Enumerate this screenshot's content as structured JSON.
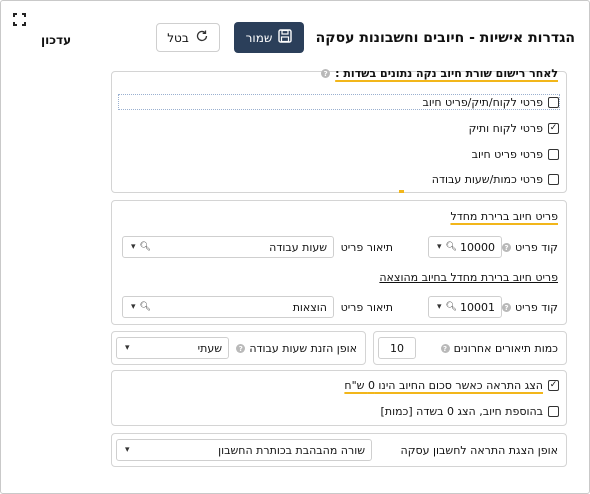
{
  "header": {
    "title": "הגדרות אישיות - חיובים וחשבונות עסקה",
    "update_label": "עדכון",
    "save_label": "שמור",
    "cancel_label": "בטל"
  },
  "section_after_line": {
    "heading": "לאחר רישום שורת חיוב נקה נתונים בשדות :",
    "options": [
      {
        "label": "פרטי לקוח/תיק/פריט חיוב",
        "checked": false
      },
      {
        "label": "פרטי לקוח ותיק",
        "checked": true
      },
      {
        "label": "פרטי פריט חיוב",
        "checked": false
      },
      {
        "label": "פרטי כמות/שעות עבודה",
        "checked": false
      }
    ]
  },
  "section_default_item": {
    "heading": "פריט חיוב ברירת מחדל",
    "code_label": "קוד פריט",
    "code_value": "10000",
    "desc_label": "תיאור פריט",
    "desc_value": "שעות עבודה",
    "heading_expense": "פריט חיוב ברירת מחדל בחיוב מהוצאה",
    "expense_code_label": "קוד פריט",
    "expense_code_value": "10001",
    "expense_desc_label": "תיאור פריט",
    "expense_desc_value": "הוצאות"
  },
  "section_quantity": {
    "recent_label": "כמות תיאורים אחרונים",
    "recent_value": "10",
    "hours_mode_label": "אופן הזנת שעות עבודה",
    "hours_mode_value": "שעתי"
  },
  "section_warning": {
    "warn_zero_label": "הצג התראה כאשר סכום החיוב הינו 0 ש\"ח",
    "warn_zero_checked": true,
    "show_zero_label": "בהוספת חיוב, הצג 0 בשדה [כמות]",
    "show_zero_checked": false
  },
  "section_display": {
    "alert_mode_label": "אופן הצגת התראה לחשבון עסקה",
    "alert_mode_value": "שורה מהבהבת בכותרת החשבון"
  },
  "colors": {
    "save_bg": "#2b3f5a",
    "highlight": "#f2b61a"
  }
}
